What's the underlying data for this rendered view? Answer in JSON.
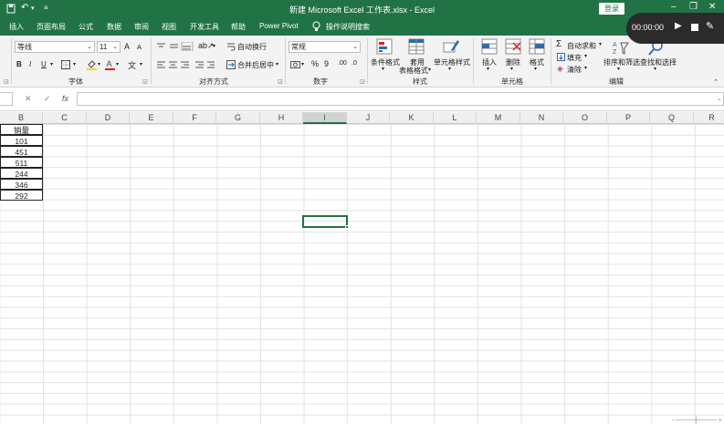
{
  "titlebar": {
    "title": "新建 Microsoft Excel 工作表.xlsx  -  Excel",
    "login_label": "登录",
    "save_icon": "save-icon",
    "undo_icon": "undo-icon",
    "redo_icon": "redo-icon",
    "customize_icon": "customize-icon",
    "minimize": "–",
    "restore": "❐",
    "close": "✕"
  },
  "tabs": [
    {
      "label": "插入"
    },
    {
      "label": "页面布局"
    },
    {
      "label": "公式"
    },
    {
      "label": "数据"
    },
    {
      "label": "审阅"
    },
    {
      "label": "视图"
    },
    {
      "label": "开发工具"
    },
    {
      "label": "帮助"
    },
    {
      "label": "Power Pivot"
    }
  ],
  "tell_me": {
    "icon": "lightbulb-icon",
    "label": "操作说明搜索"
  },
  "recorder": {
    "time": "00:00:00"
  },
  "ribbon": {
    "font": {
      "name": "等线",
      "size": "11",
      "bold": "B",
      "italic": "I",
      "underline": "U",
      "grow": "A",
      "shrink": "A",
      "wen": "文",
      "group_label": "字体"
    },
    "alignment": {
      "wrap": "自动换行",
      "merge": "合并后居中",
      "group_label": "对齐方式"
    },
    "number": {
      "format": "常规",
      "percent": "%",
      "comma": "9",
      "inc": ".00",
      "dec": ".0",
      "group_label": "数字"
    },
    "styles": {
      "conditional": "条件格式",
      "table1": "套用",
      "table2": "表格格式",
      "cell_styles": "单元格样式",
      "group_label": "样式"
    },
    "cells": {
      "insert": "插入",
      "delete": "删除",
      "format": "格式",
      "group_label": "单元格"
    },
    "editing": {
      "autosum": "自动求和",
      "fill": "填充",
      "clear": "清除",
      "sort": "排序和筛选",
      "find": "查找和选择",
      "group_label": "编辑"
    }
  },
  "formula_bar": {
    "cancel": "✕",
    "enter": "✓",
    "fx": "fx",
    "value": ""
  },
  "columns": [
    "B",
    "C",
    "D",
    "E",
    "F",
    "G",
    "H",
    "I",
    "J",
    "K",
    "L",
    "M",
    "N",
    "O",
    "P",
    "Q",
    "R"
  ],
  "selected_column": "I",
  "sheet": {
    "header": "销量",
    "values": [
      "101",
      "451",
      "511",
      "244",
      "346",
      "292"
    ]
  },
  "colors": {
    "accent": "#217346",
    "ribbon": "#f3f3f3",
    "gridline": "#e3e3e3"
  }
}
